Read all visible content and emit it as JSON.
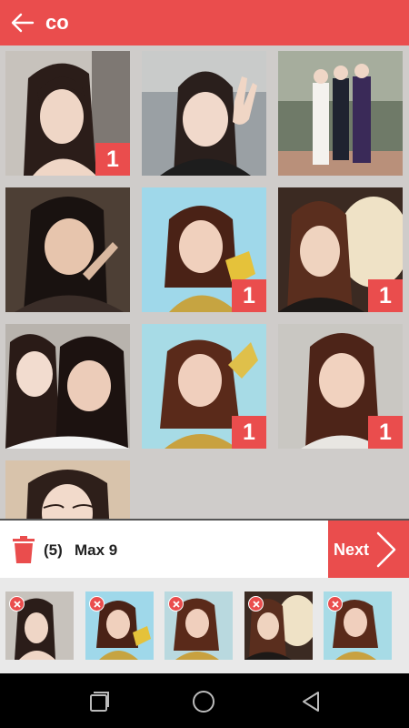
{
  "header": {
    "title": "co",
    "back_icon": "arrow-left-icon"
  },
  "grid": {
    "photos": [
      {
        "count": "1"
      },
      {
        "count": ""
      },
      {
        "count": ""
      },
      {
        "count": ""
      },
      {
        "count": "1"
      },
      {
        "count": "1"
      },
      {
        "count": ""
      },
      {
        "count": "1"
      },
      {
        "count": "1"
      },
      {
        "count": ""
      }
    ]
  },
  "selection": {
    "count_text": "(5)",
    "max_text": "Max 9",
    "next_label": "Next",
    "trash_icon": "trash-icon"
  },
  "tray": {
    "remove_icon": "remove-x-icon",
    "item_count": 5
  },
  "colors": {
    "accent": "#ea4d4d",
    "grid_bg": "#cfccca",
    "tray_bg": "#e9e9e9"
  },
  "navbar": {
    "icons": [
      "recents-icon",
      "home-icon",
      "back-triangle-icon"
    ]
  }
}
